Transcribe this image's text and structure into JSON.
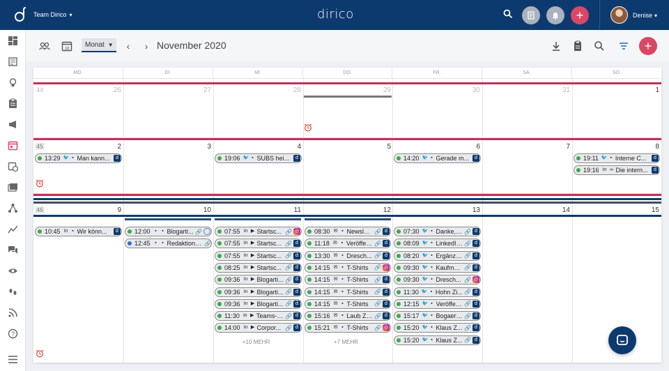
{
  "app": {
    "brand": "dirico",
    "team": "Team Dirico",
    "user": "Denise"
  },
  "colors": {
    "navy": "#0d3a6e",
    "accent": "#d94767",
    "green": "#3fa84a",
    "blue": "#2e6fd1"
  },
  "toolbar": {
    "view_label": "Monat",
    "period": "November 2020"
  },
  "days": [
    "MO.",
    "DI.",
    "MI.",
    "DO.",
    "FR.",
    "SA.",
    "SO."
  ],
  "weeks": [
    {
      "weeknum": "44",
      "dates": [
        "26",
        "27",
        "28",
        "29",
        "30",
        "31",
        "1"
      ]
    },
    {
      "weeknum": "45",
      "dates": [
        "2",
        "3",
        "4",
        "5",
        "6",
        "7",
        "8"
      ]
    },
    {
      "weeknum": "46",
      "dates": [
        "9",
        "10",
        "11",
        "12",
        "13",
        "14",
        "15"
      ]
    }
  ],
  "events": {
    "w2_mo": [
      {
        "time": "13:29",
        "label": "Man kann..."
      }
    ],
    "w2_mi": [
      {
        "time": "19:06",
        "label": "SUBS hei..."
      }
    ],
    "w2_fr": [
      {
        "time": "14:20",
        "label": "Gerade m..."
      }
    ],
    "w2_so": [
      {
        "time": "19:11",
        "label": "Interne C..."
      },
      {
        "time": "19:16",
        "label": "Die intern..."
      }
    ],
    "w3_mo": [
      {
        "time": "10:45",
        "label": "Wir könn..."
      }
    ],
    "w3_di": [
      {
        "time": "12:00",
        "label": "Blogarti..."
      },
      {
        "time": "12:45",
        "label": "Redaktions..."
      }
    ],
    "w3_mi": [
      {
        "time": "07:55",
        "label": "Startsc..."
      },
      {
        "time": "07:55",
        "label": "Startsc..."
      },
      {
        "time": "07:55",
        "label": "Startsc..."
      },
      {
        "time": "08:25",
        "label": "Startsc..."
      },
      {
        "time": "09:36",
        "label": "Blogarti..."
      },
      {
        "time": "09:36",
        "label": "Blogarti..."
      },
      {
        "time": "09:36",
        "label": "Blogarti..."
      },
      {
        "time": "11:30",
        "label": "Teams-Nac..."
      },
      {
        "time": "14:00",
        "label": "Corpor..."
      }
    ],
    "w3_do": [
      {
        "time": "08:30",
        "label": "Newsletter ..."
      },
      {
        "time": "11:18",
        "label": "Veröffentl..."
      },
      {
        "time": "13:30",
        "label": "Dresch..."
      },
      {
        "time": "14:15",
        "label": "T-Shirts"
      },
      {
        "time": "14:15",
        "label": "T-Shirts"
      },
      {
        "time": "14:15",
        "label": "T-Shirts"
      },
      {
        "time": "14:15",
        "label": "T-Shirts"
      },
      {
        "time": "15:16",
        "label": "Laub Zi..."
      },
      {
        "time": "15:21",
        "label": "T-Shirts"
      }
    ],
    "w3_fr": [
      {
        "time": "07:30",
        "label": "Danke, ge..."
      },
      {
        "time": "08:09",
        "label": "LinkedIn ..."
      },
      {
        "time": "08:20",
        "label": "Ergänzen ..."
      },
      {
        "time": "09:30",
        "label": "Kaufma..."
      },
      {
        "time": "09:30",
        "label": "Dresch..."
      },
      {
        "time": "11:30",
        "label": "Hohn Zi..."
      },
      {
        "time": "12:15",
        "label": "Veröffentl..."
      },
      {
        "time": "15:17",
        "label": "Bogaert..."
      },
      {
        "time": "15:20",
        "label": "Klaus Z..."
      },
      {
        "time": "15:20",
        "label": "Klaus Z..."
      }
    ]
  },
  "more": {
    "w3_mi": "+10 MEHR",
    "w3_do": "+7 MEHR"
  }
}
